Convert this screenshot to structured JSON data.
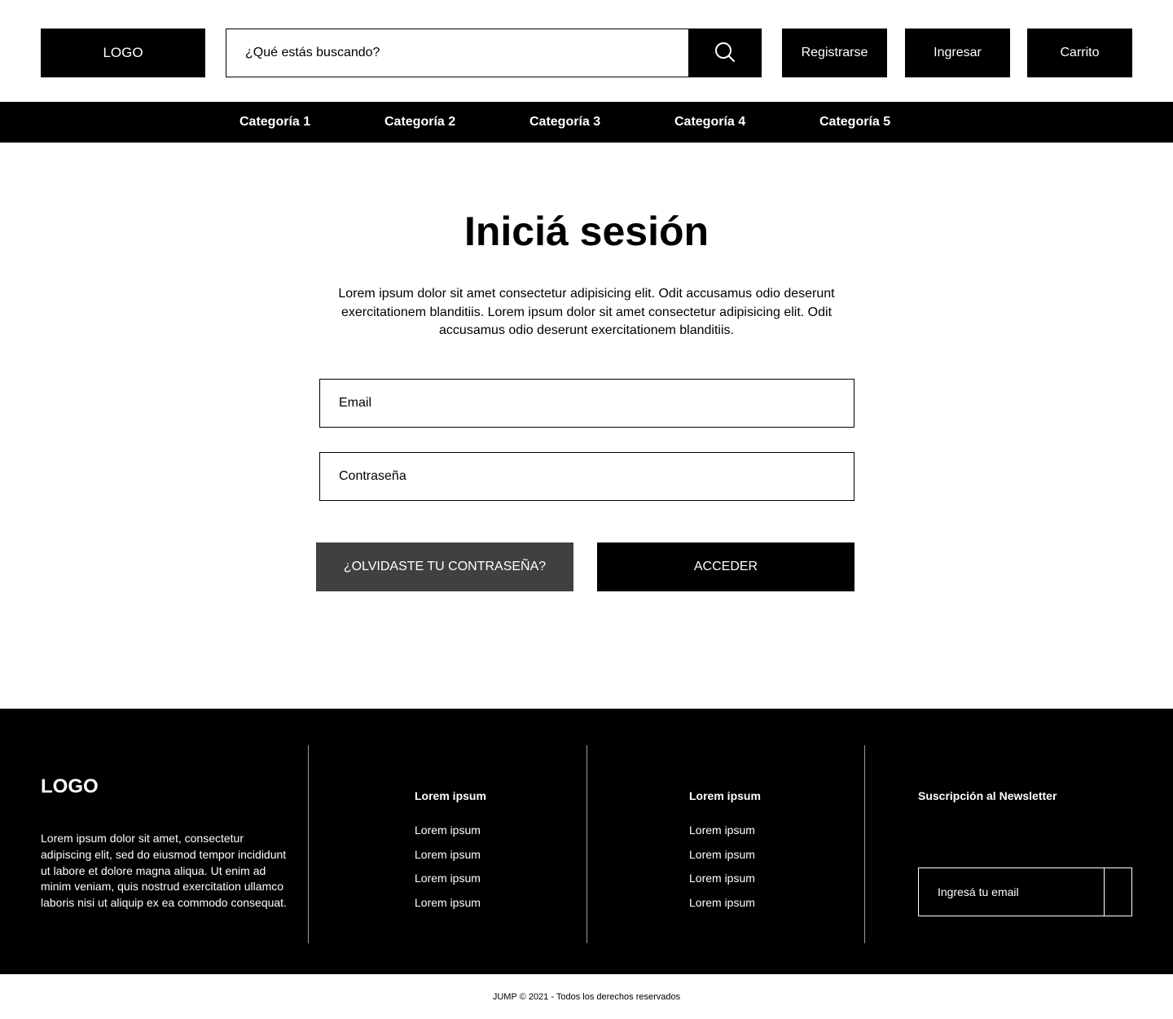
{
  "header": {
    "logo": "LOGO",
    "search_placeholder": "¿Qué estás buscando?",
    "search_icon": "search-icon",
    "register_label": "Registrarse",
    "login_label": "Ingresar",
    "cart_label": "Carrito"
  },
  "nav": {
    "categories": [
      "Categoría 1",
      "Categoría 2",
      "Categoría 3",
      "Categoría 4",
      "Categoría 5"
    ]
  },
  "main": {
    "title": "Iniciá sesión",
    "intro": "Lorem ipsum dolor sit amet consectetur adipisicing elit. Odit accusamus odio deserunt exercitationem blanditiis. Lorem ipsum dolor sit amet consectetur adipisicing elit. Odit accusamus odio deserunt exercitationem blanditiis.",
    "email_placeholder": "Email",
    "password_placeholder": "Contraseña",
    "forgot_label": "¿OLVIDASTE TU CONTRASEÑA?",
    "access_label": "ACCEDER"
  },
  "footer": {
    "logo": "LOGO",
    "description": "Lorem ipsum dolor sit amet, consectetur adipiscing elit, sed do eiusmod tempor incididunt ut labore et dolore magna aliqua. Ut enim ad minim veniam, quis nostrud exercitation ullamco laboris nisi ut aliquip ex ea commodo consequat.",
    "columns": [
      {
        "title": "Lorem ipsum",
        "links": [
          "Lorem ipsum",
          "Lorem ipsum",
          "Lorem ipsum",
          "Lorem ipsum"
        ]
      },
      {
        "title": "Lorem ipsum",
        "links": [
          "Lorem ipsum",
          "Lorem ipsum",
          "Lorem ipsum",
          "Lorem ipsum"
        ]
      }
    ],
    "newsletter_title": "Suscripción al Newsletter",
    "newsletter_placeholder": "Ingresá tu email"
  },
  "copyright": "JUMP © 2021 - Todos los derechos reservados",
  "colors": {
    "primary": "#000000",
    "secondary_button": "#404040",
    "background": "#ffffff"
  }
}
